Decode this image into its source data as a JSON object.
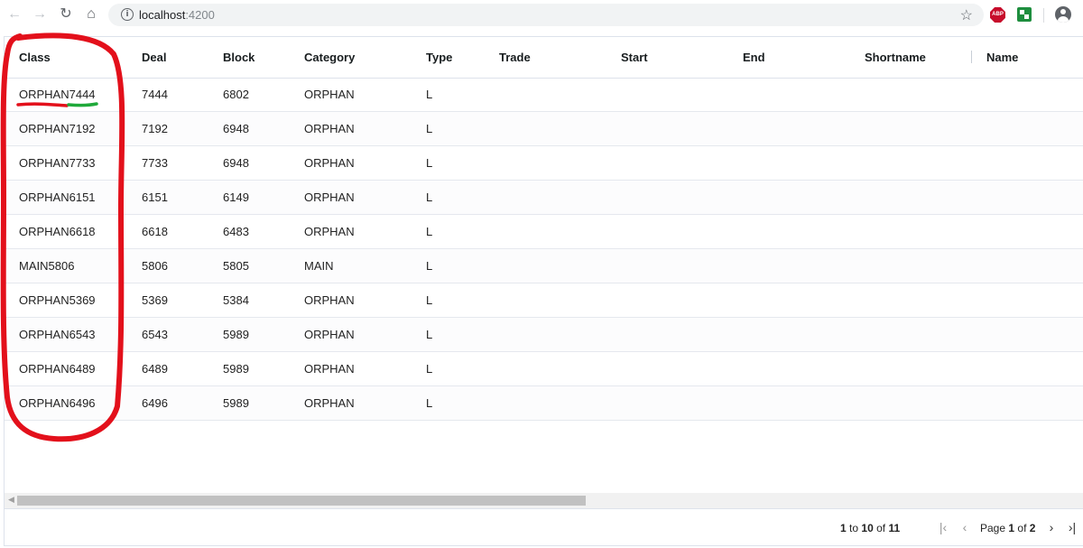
{
  "browser": {
    "url_host": "localhost",
    "url_port": ":4200",
    "icons": [
      "back-icon",
      "forward-icon",
      "reload-icon",
      "home-icon",
      "info-icon",
      "star-icon",
      "adblock-icon",
      "extension-icon",
      "profile-icon"
    ],
    "abp_label": "ABP"
  },
  "grid": {
    "columns": [
      "Class",
      "Deal",
      "Block",
      "Category",
      "Type",
      "Trade",
      "Start",
      "End",
      "Shortname",
      "Name"
    ],
    "rows": [
      {
        "class": "ORPHAN7444",
        "deal": "7444",
        "block": "6802",
        "category": "ORPHAN",
        "type": "L"
      },
      {
        "class": "ORPHAN7192",
        "deal": "7192",
        "block": "6948",
        "category": "ORPHAN",
        "type": "L"
      },
      {
        "class": "ORPHAN7733",
        "deal": "7733",
        "block": "6948",
        "category": "ORPHAN",
        "type": "L"
      },
      {
        "class": "ORPHAN6151",
        "deal": "6151",
        "block": "6149",
        "category": "ORPHAN",
        "type": "L"
      },
      {
        "class": "ORPHAN6618",
        "deal": "6618",
        "block": "6483",
        "category": "ORPHAN",
        "type": "L"
      },
      {
        "class": "MAIN5806",
        "deal": "5806",
        "block": "5805",
        "category": "MAIN",
        "type": "L"
      },
      {
        "class": "ORPHAN5369",
        "deal": "5369",
        "block": "5384",
        "category": "ORPHAN",
        "type": "L"
      },
      {
        "class": "ORPHAN6543",
        "deal": "6543",
        "block": "5989",
        "category": "ORPHAN",
        "type": "L"
      },
      {
        "class": "ORPHAN6489",
        "deal": "6489",
        "block": "5989",
        "category": "ORPHAN",
        "type": "L"
      },
      {
        "class": "ORPHAN6496",
        "deal": "6496",
        "block": "5989",
        "category": "ORPHAN",
        "type": "L"
      }
    ]
  },
  "pagination": {
    "from": "1",
    "to_word": "to",
    "to": "10",
    "of_word": "of",
    "total": "11",
    "page_word": "Page",
    "current_page": "1",
    "total_pages": "2"
  },
  "colors": {
    "annotation_red": "#e3101b",
    "annotation_green": "#1fa93a",
    "grid_border": "#dde2eb"
  }
}
